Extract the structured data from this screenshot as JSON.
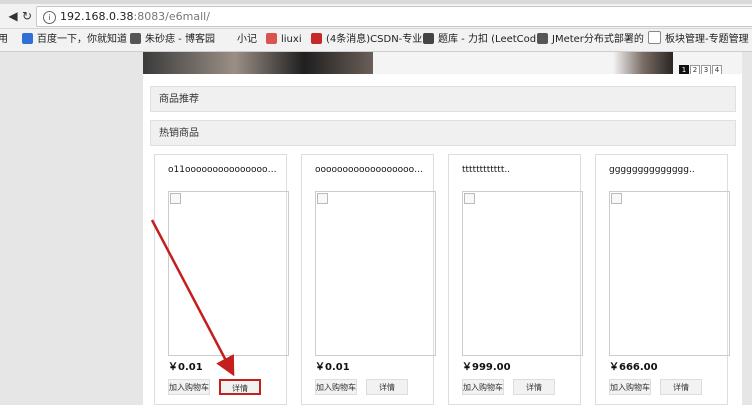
{
  "browser": {
    "url_host": "192.168.0.38",
    "url_rest": ":8083/e6mall/",
    "bookmarks": [
      {
        "label": "用",
        "color": "#f2f2f2"
      },
      {
        "label": "百度一下，你就知道",
        "color": "#2f6fd6"
      },
      {
        "label": "朱砂痣 - 博客园",
        "color": "#555555"
      },
      {
        "label": "小记",
        "color": "#3aa45a"
      },
      {
        "label": "liuxi",
        "color": "#d9534f"
      },
      {
        "label": "(4条消息)CSDN-专业",
        "color": "#c62828"
      },
      {
        "label": "题库 - 力扣 (LeetCod",
        "color": "#444444"
      },
      {
        "label": "JMeter分布式部署的",
        "color": "#555555"
      },
      {
        "label": "板块管理-专题管理",
        "color": "#888888"
      }
    ]
  },
  "banner": {
    "pager": [
      "1",
      "2",
      "3",
      "4"
    ],
    "active": "1"
  },
  "sections": {
    "recommend": "商品推荐",
    "hot": "热销商品"
  },
  "products": [
    {
      "name": "o11oooooooooooooooooooo",
      "price": "￥0.01",
      "add_label": "加入购物车",
      "detail_label": "详情"
    },
    {
      "name": "ooooooooooooooooooooooo..",
      "price": "￥0.01",
      "add_label": "加入购物车",
      "detail_label": "详情"
    },
    {
      "name": "tttttttttttt..",
      "price": "￥999.00",
      "add_label": "加入购物车",
      "detail_label": "详情"
    },
    {
      "name": "gggggggggggggg..",
      "price": "￥666.00",
      "add_label": "加入购物车",
      "detail_label": "详情"
    }
  ],
  "annotation": {
    "color": "#c41e1e",
    "target": "first product detail button"
  }
}
